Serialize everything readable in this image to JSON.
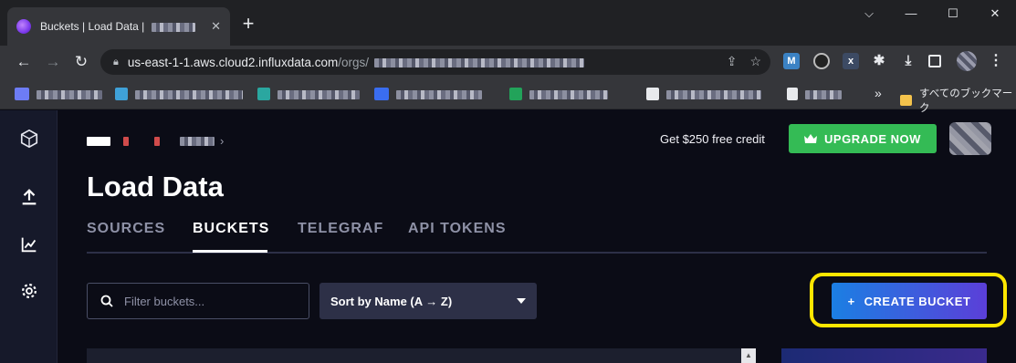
{
  "browser": {
    "tab_title": "Buckets | Load Data |",
    "tab_close": "✕",
    "new_tab": "+",
    "window_controls": [
      "⌵",
      "—",
      "☐",
      "✕"
    ],
    "url_host": "us-east-1-1.aws.cloud2.influxdata.com",
    "url_path": "/orgs/",
    "bookmarks_folder": "すべてのブックマーク",
    "bookmarks_more": "»"
  },
  "header": {
    "credit_text": "Get $250 free credit",
    "upgrade_label": "UPGRADE NOW"
  },
  "page": {
    "title": "Load Data",
    "tabs": [
      {
        "label": "SOURCES"
      },
      {
        "label": "BUCKETS",
        "active": true
      },
      {
        "label": "TELEGRAF"
      },
      {
        "label": "API TOKENS"
      }
    ]
  },
  "controls": {
    "search_placeholder": "Filter buckets...",
    "sort_label": "Sort by Name (A → Z)",
    "create_label": "CREATE BUCKET",
    "create_icon": "+"
  },
  "colors": {
    "upgrade": "#34bb55",
    "create_start": "#1b7fe3",
    "create_end": "#5b3fd8",
    "highlight": "#ffe600"
  }
}
